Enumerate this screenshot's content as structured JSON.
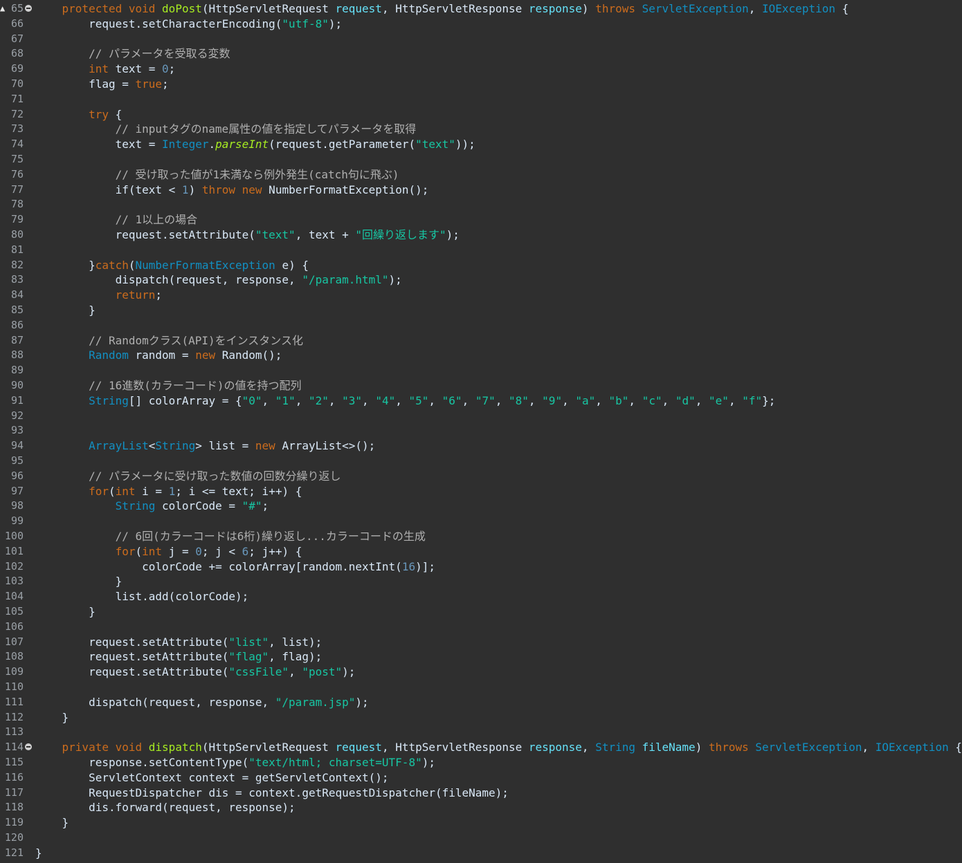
{
  "editor": {
    "lines": [
      {
        "n": "65",
        "fold": true,
        "marker": true,
        "tokens": [
          [
            "    ",
            ""
          ],
          [
            "protected",
            "kw"
          ],
          [
            " ",
            ""
          ],
          [
            "void",
            "kw"
          ],
          [
            " ",
            ""
          ],
          [
            "doPost",
            "mth"
          ],
          [
            "(HttpServletRequest ",
            ""
          ],
          [
            "request",
            "fld"
          ],
          [
            ", HttpServletResponse ",
            ""
          ],
          [
            "response",
            "fld"
          ],
          [
            ") ",
            ""
          ],
          [
            "throws",
            "kw"
          ],
          [
            " ",
            ""
          ],
          [
            "ServletException",
            "ty"
          ],
          [
            ", ",
            ""
          ],
          [
            "IOException",
            "ty"
          ],
          [
            " {",
            ""
          ]
        ]
      },
      {
        "n": "66",
        "tokens": [
          [
            "        request.setCharacterEncoding(",
            ""
          ],
          [
            "\"utf-8\"",
            "str"
          ],
          [
            ");",
            ""
          ]
        ]
      },
      {
        "n": "67",
        "tokens": []
      },
      {
        "n": "68",
        "tokens": [
          [
            "        // パラメータを受取る変数",
            "cm"
          ]
        ]
      },
      {
        "n": "69",
        "tokens": [
          [
            "        ",
            ""
          ],
          [
            "int",
            "kw"
          ],
          [
            " text = ",
            ""
          ],
          [
            "0",
            "num"
          ],
          [
            ";",
            ""
          ]
        ]
      },
      {
        "n": "70",
        "tokens": [
          [
            "        flag = ",
            ""
          ],
          [
            "true",
            "kw"
          ],
          [
            ";",
            ""
          ]
        ]
      },
      {
        "n": "71",
        "tokens": []
      },
      {
        "n": "72",
        "tokens": [
          [
            "        ",
            ""
          ],
          [
            "try",
            "kw"
          ],
          [
            " {",
            ""
          ]
        ]
      },
      {
        "n": "73",
        "tokens": [
          [
            "            // inputタグのname属性の値を指定してパラメータを取得",
            "cm"
          ]
        ]
      },
      {
        "n": "74",
        "tokens": [
          [
            "            text = ",
            ""
          ],
          [
            "Integer",
            "ty"
          ],
          [
            ".",
            ""
          ],
          [
            "parseInt",
            "mth it"
          ],
          [
            "(request.getParameter(",
            ""
          ],
          [
            "\"text\"",
            "str"
          ],
          [
            "));",
            ""
          ]
        ]
      },
      {
        "n": "75",
        "tokens": []
      },
      {
        "n": "76",
        "tokens": [
          [
            "            // 受け取った値が1未満なら例外発生(catch句に飛ぶ)",
            "cm"
          ]
        ]
      },
      {
        "n": "77",
        "tokens": [
          [
            "            if(text < ",
            ""
          ],
          [
            "1",
            "num"
          ],
          [
            ") ",
            ""
          ],
          [
            "throw",
            "kw"
          ],
          [
            " ",
            ""
          ],
          [
            "new",
            "kw"
          ],
          [
            " NumberFormatException();",
            ""
          ]
        ]
      },
      {
        "n": "78",
        "tokens": []
      },
      {
        "n": "79",
        "tokens": [
          [
            "            // 1以上の場合",
            "cm"
          ]
        ]
      },
      {
        "n": "80",
        "tokens": [
          [
            "            request.setAttribute(",
            ""
          ],
          [
            "\"text\"",
            "str"
          ],
          [
            ", text + ",
            ""
          ],
          [
            "\"回繰り返します\"",
            "str"
          ],
          [
            ");",
            ""
          ]
        ]
      },
      {
        "n": "81",
        "tokens": []
      },
      {
        "n": "82",
        "tokens": [
          [
            "        }",
            ""
          ],
          [
            "catch",
            "kw"
          ],
          [
            "(",
            ""
          ],
          [
            "NumberFormatException",
            "ty"
          ],
          [
            " e) {",
            ""
          ]
        ]
      },
      {
        "n": "83",
        "tokens": [
          [
            "            dispatch(request, response, ",
            ""
          ],
          [
            "\"/param.html\"",
            "str"
          ],
          [
            ");",
            ""
          ]
        ]
      },
      {
        "n": "84",
        "tokens": [
          [
            "            ",
            ""
          ],
          [
            "return",
            "kw"
          ],
          [
            ";",
            ""
          ]
        ]
      },
      {
        "n": "85",
        "tokens": [
          [
            "        }",
            ""
          ]
        ]
      },
      {
        "n": "86",
        "tokens": []
      },
      {
        "n": "87",
        "tokens": [
          [
            "        // Randomクラス(API)をインスタンス化",
            "cm"
          ]
        ]
      },
      {
        "n": "88",
        "tokens": [
          [
            "        ",
            ""
          ],
          [
            "Random",
            "ty"
          ],
          [
            " random = ",
            ""
          ],
          [
            "new",
            "kw"
          ],
          [
            " Random();",
            ""
          ]
        ]
      },
      {
        "n": "89",
        "tokens": []
      },
      {
        "n": "90",
        "tokens": [
          [
            "        // 16進数(カラーコード)の値を持つ配列",
            "cm"
          ]
        ]
      },
      {
        "n": "91",
        "tokens": [
          [
            "        ",
            ""
          ],
          [
            "String",
            "ty"
          ],
          [
            "[] colorArray = {",
            ""
          ],
          [
            "\"0\"",
            "str"
          ],
          [
            ", ",
            ""
          ],
          [
            "\"1\"",
            "str"
          ],
          [
            ", ",
            ""
          ],
          [
            "\"2\"",
            "str"
          ],
          [
            ", ",
            ""
          ],
          [
            "\"3\"",
            "str"
          ],
          [
            ", ",
            ""
          ],
          [
            "\"4\"",
            "str"
          ],
          [
            ", ",
            ""
          ],
          [
            "\"5\"",
            "str"
          ],
          [
            ", ",
            ""
          ],
          [
            "\"6\"",
            "str"
          ],
          [
            ", ",
            ""
          ],
          [
            "\"7\"",
            "str"
          ],
          [
            ", ",
            ""
          ],
          [
            "\"8\"",
            "str"
          ],
          [
            ", ",
            ""
          ],
          [
            "\"9\"",
            "str"
          ],
          [
            ", ",
            ""
          ],
          [
            "\"a\"",
            "str"
          ],
          [
            ", ",
            ""
          ],
          [
            "\"b\"",
            "str"
          ],
          [
            ", ",
            ""
          ],
          [
            "\"c\"",
            "str"
          ],
          [
            ", ",
            ""
          ],
          [
            "\"d\"",
            "str"
          ],
          [
            ", ",
            ""
          ],
          [
            "\"e\"",
            "str"
          ],
          [
            ", ",
            ""
          ],
          [
            "\"f\"",
            "str"
          ],
          [
            "};",
            ""
          ]
        ]
      },
      {
        "n": "92",
        "tokens": []
      },
      {
        "n": "93",
        "tokens": []
      },
      {
        "n": "94",
        "tokens": [
          [
            "        ",
            ""
          ],
          [
            "ArrayList",
            "ty"
          ],
          [
            "<",
            ""
          ],
          [
            "String",
            "ty"
          ],
          [
            "> list = ",
            ""
          ],
          [
            "new",
            "kw"
          ],
          [
            " ArrayList<>();",
            ""
          ]
        ]
      },
      {
        "n": "95",
        "tokens": []
      },
      {
        "n": "96",
        "tokens": [
          [
            "        // パラメータに受け取った数値の回数分繰り返し",
            "cm"
          ]
        ]
      },
      {
        "n": "97",
        "tokens": [
          [
            "        ",
            ""
          ],
          [
            "for",
            "kw"
          ],
          [
            "(",
            ""
          ],
          [
            "int",
            "kw"
          ],
          [
            " i = ",
            ""
          ],
          [
            "1",
            "num"
          ],
          [
            "; i <= text; i++) {",
            ""
          ]
        ]
      },
      {
        "n": "98",
        "tokens": [
          [
            "            ",
            ""
          ],
          [
            "String",
            "ty"
          ],
          [
            " colorCode = ",
            ""
          ],
          [
            "\"#\"",
            "str"
          ],
          [
            ";",
            ""
          ]
        ]
      },
      {
        "n": "99",
        "tokens": []
      },
      {
        "n": "100",
        "tokens": [
          [
            "            // 6回(カラーコードは6桁)繰り返し...カラーコードの生成",
            "cm"
          ]
        ]
      },
      {
        "n": "101",
        "tokens": [
          [
            "            ",
            ""
          ],
          [
            "for",
            "kw"
          ],
          [
            "(",
            ""
          ],
          [
            "int",
            "kw"
          ],
          [
            " j = ",
            ""
          ],
          [
            "0",
            "num"
          ],
          [
            "; j < ",
            ""
          ],
          [
            "6",
            "num"
          ],
          [
            "; j++) {",
            ""
          ]
        ]
      },
      {
        "n": "102",
        "tokens": [
          [
            "                colorCode += colorArray[random.nextInt(",
            ""
          ],
          [
            "16",
            "num"
          ],
          [
            ")];",
            ""
          ]
        ]
      },
      {
        "n": "103",
        "tokens": [
          [
            "            }",
            ""
          ]
        ]
      },
      {
        "n": "104",
        "tokens": [
          [
            "            list.add(colorCode);",
            ""
          ]
        ]
      },
      {
        "n": "105",
        "tokens": [
          [
            "        }",
            ""
          ]
        ]
      },
      {
        "n": "106",
        "tokens": []
      },
      {
        "n": "107",
        "tokens": [
          [
            "        request.setAttribute(",
            ""
          ],
          [
            "\"list\"",
            "str"
          ],
          [
            ", list);",
            ""
          ]
        ]
      },
      {
        "n": "108",
        "tokens": [
          [
            "        request.setAttribute(",
            ""
          ],
          [
            "\"flag\"",
            "str"
          ],
          [
            ", flag);",
            ""
          ]
        ]
      },
      {
        "n": "109",
        "tokens": [
          [
            "        request.setAttribute(",
            ""
          ],
          [
            "\"cssFile\"",
            "str"
          ],
          [
            ", ",
            ""
          ],
          [
            "\"post\"",
            "str"
          ],
          [
            ");",
            ""
          ]
        ]
      },
      {
        "n": "110",
        "tokens": []
      },
      {
        "n": "111",
        "tokens": [
          [
            "        dispatch(request, response, ",
            ""
          ],
          [
            "\"/param.jsp\"",
            "str"
          ],
          [
            ");",
            ""
          ]
        ]
      },
      {
        "n": "112",
        "tokens": [
          [
            "    }",
            ""
          ]
        ]
      },
      {
        "n": "113",
        "tokens": []
      },
      {
        "n": "114",
        "fold": true,
        "tokens": [
          [
            "    ",
            ""
          ],
          [
            "private",
            "kw"
          ],
          [
            " ",
            ""
          ],
          [
            "void",
            "kw"
          ],
          [
            " ",
            ""
          ],
          [
            "dispatch",
            "mth"
          ],
          [
            "(HttpServletRequest ",
            ""
          ],
          [
            "request",
            "fld"
          ],
          [
            ", HttpServletResponse ",
            ""
          ],
          [
            "response",
            "fld"
          ],
          [
            ", ",
            ""
          ],
          [
            "String",
            "ty"
          ],
          [
            " ",
            ""
          ],
          [
            "fileName",
            "fld"
          ],
          [
            ") ",
            ""
          ],
          [
            "throws",
            "kw"
          ],
          [
            " ",
            ""
          ],
          [
            "ServletException",
            "ty"
          ],
          [
            ", ",
            ""
          ],
          [
            "IOException",
            "ty"
          ],
          [
            " {",
            ""
          ]
        ]
      },
      {
        "n": "115",
        "tokens": [
          [
            "        response.setContentType(",
            ""
          ],
          [
            "\"text/html; charset=UTF-8\"",
            "str"
          ],
          [
            ");",
            ""
          ]
        ]
      },
      {
        "n": "116",
        "tokens": [
          [
            "        ServletContext context = getServletContext();",
            ""
          ]
        ]
      },
      {
        "n": "117",
        "tokens": [
          [
            "        RequestDispatcher dis = context.getRequestDispatcher(fileName);",
            ""
          ]
        ]
      },
      {
        "n": "118",
        "tokens": [
          [
            "        dis.forward(request, response);",
            ""
          ]
        ]
      },
      {
        "n": "119",
        "tokens": [
          [
            "    }",
            ""
          ]
        ]
      },
      {
        "n": "120",
        "tokens": []
      },
      {
        "n": "121",
        "tokens": [
          [
            "}",
            ""
          ]
        ]
      }
    ]
  }
}
